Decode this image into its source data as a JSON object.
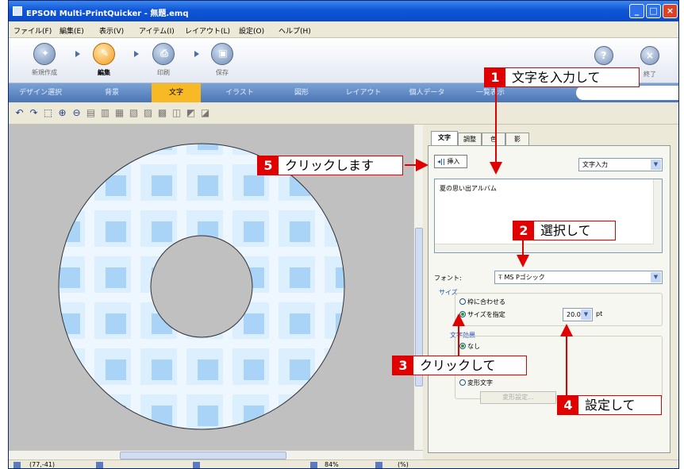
{
  "window": {
    "title": "EPSON Multi-PrintQuicker - 無題.emq",
    "controls": [
      "_",
      "□",
      "×"
    ]
  },
  "menu": [
    "ファイル(F)",
    "編集(E)",
    "表示(V)",
    "アイテム(I)",
    "レイアウト(L)",
    "設定(O)",
    "ヘルプ(H)"
  ],
  "steps": [
    {
      "label": "新規作成",
      "icon": "new-icon"
    },
    {
      "label": "編集",
      "icon": "edit-icon",
      "active": true
    },
    {
      "label": "印刷",
      "icon": "print-icon"
    },
    {
      "label": "保存",
      "icon": "save-icon"
    }
  ],
  "help_button": "?",
  "close_button": "×",
  "exit_label": "終了",
  "tabs": [
    "デザイン選択",
    "背景",
    "文字",
    "イラスト",
    "図形",
    "レイアウト",
    "個人データ",
    "一覧表示"
  ],
  "active_tab": "文字",
  "panel": {
    "tabs": [
      "文字",
      "調整",
      "色",
      "影"
    ],
    "insert_button": "挿入",
    "mode_select": "文字入力",
    "text_value": "夏の思い出アルバム",
    "font_label": "フォント:",
    "font_value": "MS Pゴシック",
    "size_group": "サイズ",
    "size_fit": "枠に合わせる",
    "size_specify": "サイズを指定",
    "size_value": "20.0",
    "size_unit": "pt",
    "effect_group": "文字効果",
    "effect_none": "なし",
    "effect_deform": "変形文字",
    "deform_button": "変形設定..."
  },
  "status": {
    "coords": "(77,-41)",
    "zoom": "84%",
    "extra": "(%)"
  },
  "callouts": [
    {
      "num": "1",
      "text": "文字を入力して"
    },
    {
      "num": "2",
      "text": "選択して"
    },
    {
      "num": "3",
      "text": "クリックして"
    },
    {
      "num": "4",
      "text": "設定して"
    },
    {
      "num": "5",
      "text": "クリックします"
    }
  ],
  "colors": {
    "accent_red": "#e00000",
    "tab_active": "#f7b924",
    "disc_light": "#dcefff",
    "disc_dark": "#a9d4f7"
  }
}
